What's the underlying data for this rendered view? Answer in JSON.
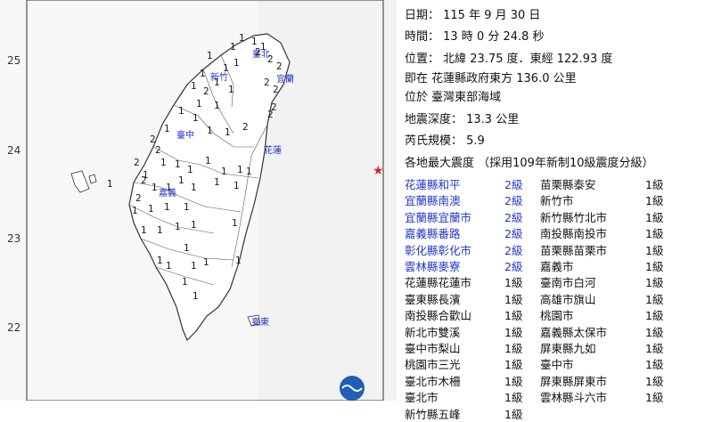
{
  "report": {
    "date_line": "日期： 115 年 9 月 30 日",
    "time_line": "時間： 13 時 0 分 24.8 秒",
    "location_line": "位置： 北緯 23.75 度．東經 122.93 度",
    "relative_line": "即在 花蓮縣政府東方 136.0 公里",
    "region_line": "位於 臺灣東部海域",
    "depth_line": "地震深度： 13.3 公里",
    "magnitude_line": "芮氏規模： 5.9",
    "max_title": "各地最大震度 （採用109年新制10級震度分級）"
  },
  "intensity_table": [
    {
      "left": {
        "name": "花蓮縣和平",
        "level": "2級",
        "highlight": true
      },
      "right": {
        "name": "苗栗縣泰安",
        "level": "1級"
      }
    },
    {
      "left": {
        "name": "宜蘭縣南澳",
        "level": "2級",
        "highlight": true
      },
      "right": {
        "name": "新竹市",
        "level": "1級"
      }
    },
    {
      "left": {
        "name": "宜蘭縣宜蘭市",
        "level": "2級",
        "highlight": true
      },
      "right": {
        "name": "新竹縣竹北市",
        "level": "1級"
      }
    },
    {
      "left": {
        "name": "嘉義縣番路",
        "level": "2級",
        "highlight": true
      },
      "right": {
        "name": "南投縣南投市",
        "level": "1級"
      }
    },
    {
      "left": {
        "name": "彰化縣彰化市",
        "level": "2級",
        "highlight": true
      },
      "right": {
        "name": "苗栗縣苗栗市",
        "level": "1級"
      }
    },
    {
      "left": {
        "name": "雲林縣麥寮",
        "level": "2級",
        "highlight": true
      },
      "right": {
        "name": "嘉義市",
        "level": "1級"
      }
    },
    {
      "left": {
        "name": "花蓮縣花蓮市",
        "level": "1級",
        "highlight": false
      },
      "right": {
        "name": "臺南市白河",
        "level": "1級"
      }
    },
    {
      "left": {
        "name": "臺東縣長濱",
        "level": "1級",
        "highlight": false
      },
      "right": {
        "name": "高雄市旗山",
        "level": "1級"
      }
    },
    {
      "left": {
        "name": "南投縣合歡山",
        "level": "1級",
        "highlight": false
      },
      "right": {
        "name": "桃園市",
        "level": "1級"
      }
    },
    {
      "left": {
        "name": "新北市雙溪",
        "level": "1級",
        "highlight": false
      },
      "right": {
        "name": "嘉義縣太保市",
        "level": "1級"
      }
    },
    {
      "left": {
        "name": "臺中市梨山",
        "level": "1級",
        "highlight": false
      },
      "right": {
        "name": "屏東縣九如",
        "level": "1級"
      }
    },
    {
      "left": {
        "name": "桃園市三光",
        "level": "1級",
        "highlight": false
      },
      "right": {
        "name": "臺中市",
        "level": "1級"
      }
    },
    {
      "left": {
        "name": "臺北市木柵",
        "level": "1級",
        "highlight": false
      },
      "right": {
        "name": "屏東縣屏東市",
        "level": "1級"
      }
    },
    {
      "left": {
        "name": "臺北市",
        "level": "1級",
        "highlight": false
      },
      "right": {
        "name": "雲林縣斗六市",
        "level": "1級"
      }
    },
    {
      "left": {
        "name": "新竹縣五峰",
        "level": "1級",
        "highlight": false
      },
      "right": {
        "name": "",
        "level": ""
      }
    }
  ],
  "map": {
    "lat_labels": [
      "25",
      "24",
      "23",
      "22"
    ],
    "city_labels": [
      "臺北",
      "新竹",
      "宜蘭",
      "臺中",
      "花蓮",
      "嘉義",
      "臺東"
    ],
    "marker_2": [
      "2",
      "2",
      "2",
      "2",
      "2",
      "2",
      "2",
      "2",
      "2",
      "2",
      "2",
      "2",
      "2",
      "2"
    ],
    "marker_1": [
      "1",
      "1",
      "1",
      "1",
      "1",
      "1",
      "1",
      "1",
      "1",
      "1",
      "1",
      "1",
      "1",
      "1",
      "1",
      "1",
      "1",
      "1",
      "1",
      "1",
      "1",
      "1",
      "1",
      "1",
      "1",
      "1",
      "1",
      "1",
      "1",
      "1",
      "1",
      "1",
      "1",
      "1",
      "1",
      "1",
      "1",
      "1",
      "1",
      "1",
      "1",
      "1",
      "1",
      "1",
      "1",
      "1",
      "1",
      "1",
      "1",
      "1"
    ],
    "epicenter_symbol": "★",
    "logo": "CWA",
    "colors": {
      "land": "#f4f4f4",
      "sea": "#ffffff",
      "border": "#333333",
      "highlight": "#1f36c9",
      "epicenter": "#e0202a"
    }
  }
}
